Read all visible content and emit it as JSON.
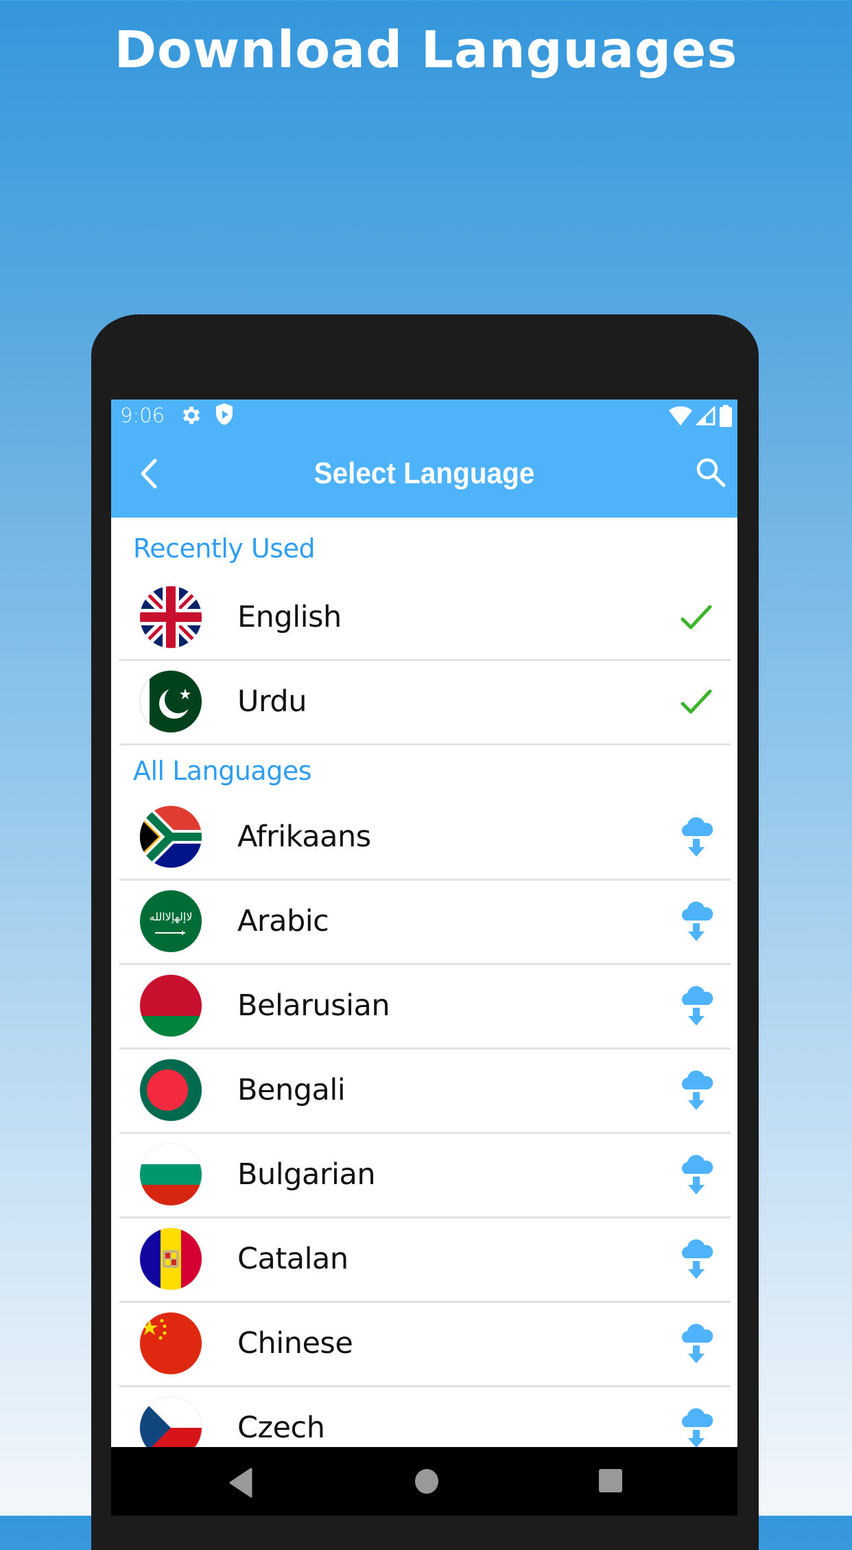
{
  "headline": "Download Languages",
  "statusbar": {
    "time": "9:06",
    "left_icons": [
      "gear-icon",
      "shield-play-icon"
    ],
    "right_icons": [
      "wifi-icon",
      "signal-icon",
      "battery-icon"
    ]
  },
  "appbar": {
    "title": "Select Language",
    "back_icon": "chevron-left-icon",
    "search_icon": "search-icon"
  },
  "colors": {
    "accent": "#4fb3fb",
    "section_title": "#2f9df0",
    "check": "#3cb52c",
    "download": "#4fb3fb",
    "bezel": "#1c1c1c"
  },
  "recently_used": {
    "title": "Recently Used",
    "items": [
      {
        "name": "English",
        "flag": "uk",
        "status": "installed",
        "status_icon": "check-icon"
      },
      {
        "name": "Urdu",
        "flag": "pk",
        "status": "installed",
        "status_icon": "check-icon"
      }
    ]
  },
  "all_languages": {
    "title": "All Languages",
    "items": [
      {
        "name": "Afrikaans",
        "flag": "za",
        "status": "download",
        "status_icon": "cloud-download-icon"
      },
      {
        "name": "Arabic",
        "flag": "sa",
        "status": "download",
        "status_icon": "cloud-download-icon"
      },
      {
        "name": "Belarusian",
        "flag": "by",
        "status": "download",
        "status_icon": "cloud-download-icon"
      },
      {
        "name": "Bengali",
        "flag": "bd",
        "status": "download",
        "status_icon": "cloud-download-icon"
      },
      {
        "name": "Bulgarian",
        "flag": "bg",
        "status": "download",
        "status_icon": "cloud-download-icon"
      },
      {
        "name": "Catalan",
        "flag": "ad",
        "status": "download",
        "status_icon": "cloud-download-icon"
      },
      {
        "name": "Chinese",
        "flag": "cn",
        "status": "download",
        "status_icon": "cloud-download-icon"
      },
      {
        "name": "Czech",
        "flag": "cz",
        "status": "download",
        "status_icon": "cloud-download-icon"
      }
    ]
  },
  "navbar": {
    "buttons": [
      "back-triangle-icon",
      "home-circle-icon",
      "recents-square-icon"
    ]
  }
}
